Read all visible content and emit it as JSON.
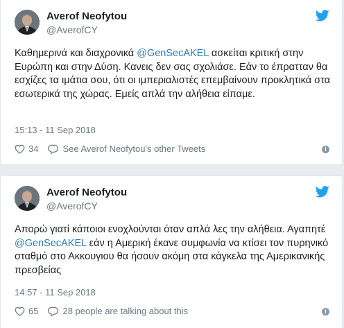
{
  "tweets": [
    {
      "author_name": "Averof Neofytou",
      "author_handle": "@AverofCY",
      "text_before": "Καθημερινά και διαχρονικά ",
      "mention": "@GenSecAKEL",
      "text_after": " ασκείται κριτική στην Ευρώπη και στην Δύση. Κανεις δεν σας σχολιάσε. Εάν το έπρατταν θα εσχίζες τα ιμάτια σου, ότι οι ιμπεριαλιστές επεμβαίνουν προκλητικά στα εσωτερικά της χώρας. Εμείς απλά την αλήθεια είπαμε.",
      "timestamp": "15:13 - 11 Sep 2018",
      "likes": "34",
      "secondary_action": "See Averof Neofytou's other Tweets"
    },
    {
      "author_name": "Averof Neofytou",
      "author_handle": "@AverofCY",
      "text_before": "Απορώ γιατί κάποιοι ενοχλούνται όταν απλά λες την αλήθεια. Αγαπητέ ",
      "mention": "@GenSecAKEL",
      "text_after": " εάν η Αμερική έκανε συμφωνία να κτίσει τον πυρηνικό σταθμό στο Ακκουγιου θα ήσουν ακόμη στα κάγκελα της Αμερικανικής πρεσβείας",
      "timestamp": "14:57 - 11 Sep 2018",
      "likes": "65",
      "secondary_action": "28 people are talking about this"
    }
  ],
  "colors": {
    "link": "#2b7bb9",
    "twitter_blue": "#1da1f2",
    "muted": "#697882",
    "text": "#1c2022"
  },
  "icons": {
    "brand": "twitter-bird-icon",
    "like": "heart-icon",
    "reply": "speech-bubble-icon",
    "info": "info-icon"
  }
}
